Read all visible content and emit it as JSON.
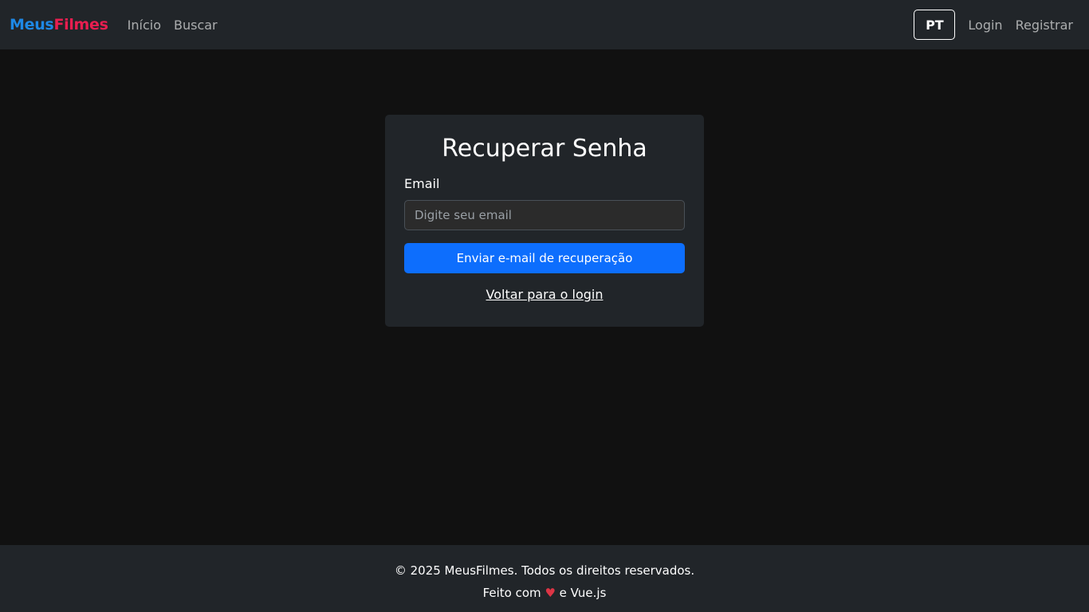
{
  "navbar": {
    "brand_part1": "Meus",
    "brand_part2": "Filmes",
    "links": [
      "Início",
      "Buscar"
    ],
    "language": "PT",
    "login": "Login",
    "register": "Registrar"
  },
  "card": {
    "title": "Recuperar Senha",
    "email_label": "Email",
    "email_placeholder": "Digite seu email",
    "email_value": "",
    "submit_label": "Enviar e-mail de recuperação",
    "back_link": "Voltar para o login"
  },
  "footer": {
    "copyright": "© 2025 MeusFilmes. Todos os direitos reservados.",
    "made_with_prefix": "Feito com",
    "heart": "♥",
    "made_with_suffix": "e Vue.js"
  },
  "colors": {
    "brand_blue": "#1e88e5",
    "brand_red": "#e91e50",
    "primary": "#0d6efd",
    "heart": "#dc3545"
  }
}
